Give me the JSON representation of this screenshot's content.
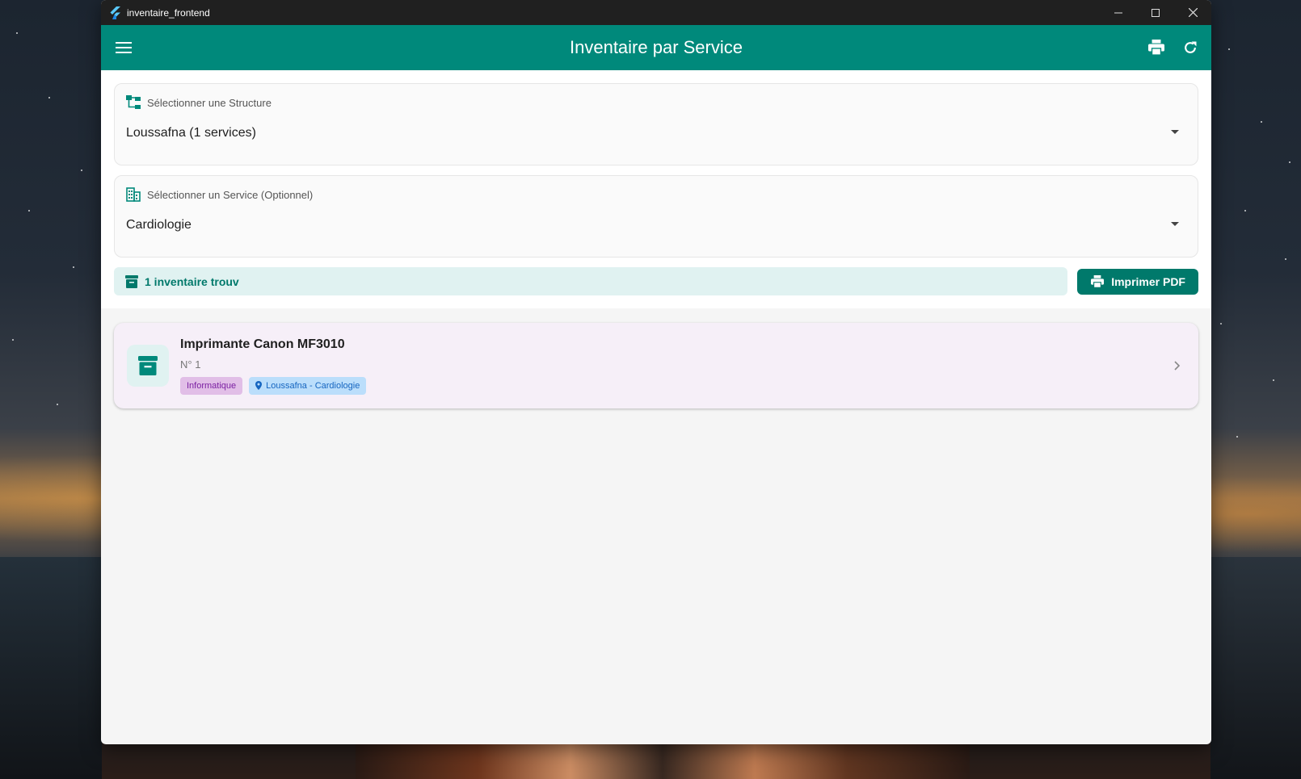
{
  "window": {
    "title": "inventaire_frontend"
  },
  "appbar": {
    "title": "Inventaire par Service"
  },
  "structure_select": {
    "label": "Sélectionner une Structure",
    "value": "Loussafna (1 services)"
  },
  "service_select": {
    "label": "Sélectionner un Service (Optionnel)",
    "value": "Cardiologie"
  },
  "results": {
    "count_text": "1 inventaire trouv",
    "print_pdf_label": "Imprimer PDF"
  },
  "items": [
    {
      "name": "Imprimante Canon MF3010",
      "number": "N° 1",
      "category": "Informatique",
      "location": "Loussafna - Cardiologie"
    }
  ],
  "colors": {
    "primary": "#00897b",
    "primary_dark": "#00796b",
    "banner_bg": "#e0f2f1",
    "card_bg": "#f6eff8",
    "tag_category_bg": "#e1bee7",
    "tag_location_bg": "#bbdefb"
  }
}
